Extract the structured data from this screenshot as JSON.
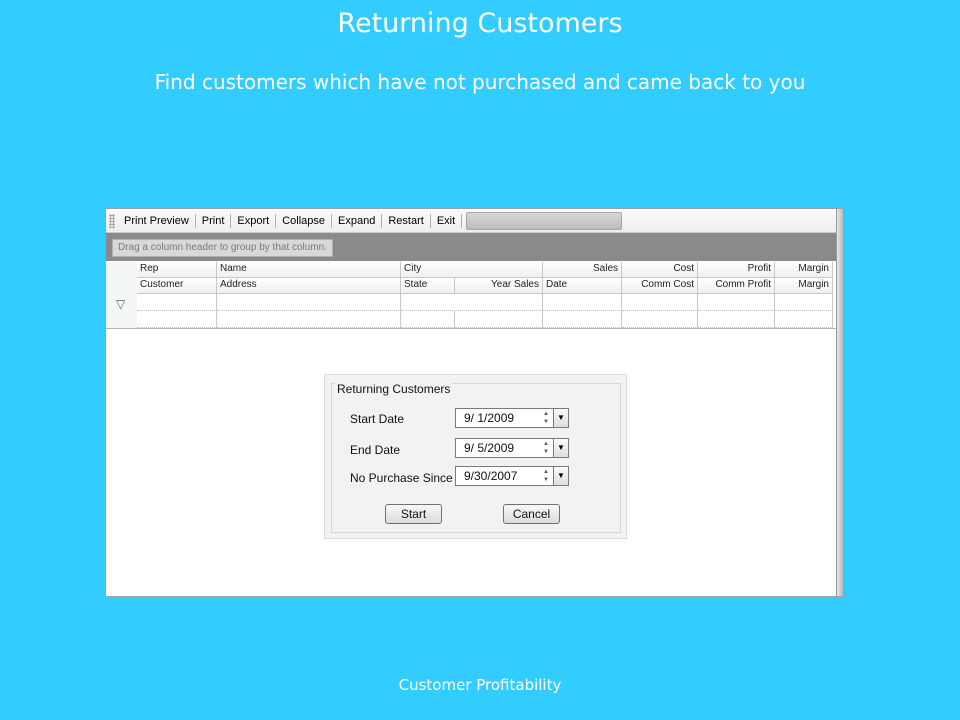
{
  "slide": {
    "title": "Returning Customers",
    "subtitle": "Find customers which have not purchased and came back to you",
    "footer": "Customer Profitability",
    "background_color": "#33ccff"
  },
  "toolbar": {
    "items": [
      "Print Preview",
      "Print",
      "Export",
      "Collapse",
      "Expand",
      "Restart",
      "Exit"
    ]
  },
  "group_panel": {
    "hint": "Drag a column header to group by that column."
  },
  "grid": {
    "header_row1": [
      "Rep",
      "Name",
      "City",
      "",
      "Sales",
      "Cost",
      "Profit",
      "Margin"
    ],
    "header_row2": [
      "Customer",
      "Address",
      "State",
      "Year Sales",
      "Date",
      "Comm Cost",
      "Comm Profit",
      "Margin"
    ],
    "filter_icon": "funnel-icon"
  },
  "dialog": {
    "group_title": "Returning Customers",
    "start_date_label": "Start Date",
    "start_date_value": "9/  1/2009",
    "end_date_label": "End Date",
    "end_date_value": "9/  5/2009",
    "no_purchase_label": "No Purchase Since",
    "no_purchase_value": "9/30/2007",
    "start_button": "Start",
    "cancel_button": "Cancel"
  }
}
